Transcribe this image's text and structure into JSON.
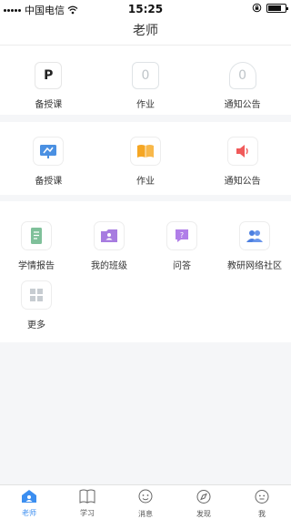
{
  "status_bar": {
    "carrier": "中国电信",
    "time": "15:25",
    "battery_level": 0.8
  },
  "header": {
    "title": "老师"
  },
  "section1": {
    "items": [
      {
        "label": "备授课",
        "glyph": "P",
        "icon": "p-document-icon"
      },
      {
        "label": "作业",
        "glyph": "0",
        "icon": "homework-zero-icon"
      },
      {
        "label": "通知公告",
        "glyph": "0",
        "icon": "bell-zero-icon"
      }
    ]
  },
  "section2": {
    "items": [
      {
        "label": "备授课",
        "icon": "teaching-board-icon",
        "color": "#4a90e2"
      },
      {
        "label": "作业",
        "icon": "open-book-icon",
        "color": "#f5a623"
      },
      {
        "label": "通知公告",
        "icon": "speaker-icon",
        "color": "#f05a5a"
      }
    ]
  },
  "section3": {
    "items": [
      {
        "label": "学情报告",
        "icon": "report-document-icon",
        "color": "#7fc09a"
      },
      {
        "label": "我的班级",
        "icon": "class-folder-icon",
        "color": "#a77ce0"
      },
      {
        "label": "问答",
        "icon": "question-chat-icon",
        "color": "#b07ee8"
      },
      {
        "label": "教研网络社区",
        "icon": "community-people-icon",
        "color": "#4c7fe0"
      },
      {
        "label": "更多",
        "icon": "more-grid-icon",
        "color": "#c7ccd1"
      }
    ]
  },
  "tab_bar": {
    "tabs": [
      {
        "label": "老师",
        "icon": "teacher-house-icon",
        "active": true
      },
      {
        "label": "学习",
        "icon": "book-icon",
        "active": false
      },
      {
        "label": "消息",
        "icon": "message-face-icon",
        "active": false
      },
      {
        "label": "发现",
        "icon": "compass-icon",
        "active": false
      },
      {
        "label": "我",
        "icon": "profile-icon",
        "active": false
      }
    ],
    "accent_color": "#3b8ef0"
  }
}
